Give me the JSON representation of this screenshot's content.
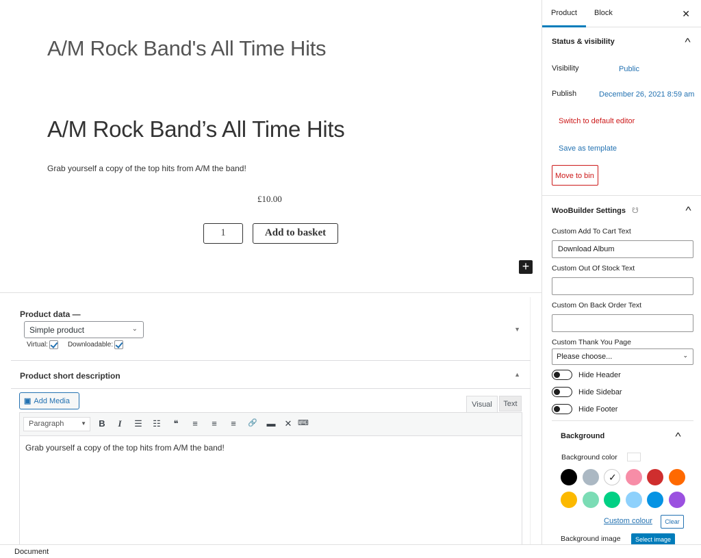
{
  "canvas": {
    "page_title": "A/M Rock Band's All Time Hits",
    "product_title": "A/M Rock Band’s All Time Hits",
    "short_description": "Grab yourself a copy of the top hits from A/M the band!",
    "price": "£10.00",
    "quantity": "1",
    "add_to_basket_label": "Add to basket",
    "add_block_icon": "+"
  },
  "product_data": {
    "label": "Product data —",
    "type_selected": "Simple product",
    "virtual_label": "Virtual:",
    "virtual_checked": true,
    "downloadable_label": "Downloadable:",
    "downloadable_checked": true,
    "toggle_icon": "▼"
  },
  "short_desc_box": {
    "label": "Product short description",
    "toggle_icon": "▲",
    "add_media_label": "Add Media",
    "tab_visual": "Visual",
    "tab_text": "Text",
    "format_selected": "Paragraph",
    "toolbar": [
      {
        "name": "bold",
        "glyph": "B"
      },
      {
        "name": "italic",
        "glyph": "I"
      },
      {
        "name": "bulleted-list",
        "glyph": "☰"
      },
      {
        "name": "numbered-list",
        "glyph": "☷"
      },
      {
        "name": "blockquote",
        "glyph": "❝"
      },
      {
        "name": "align-left",
        "glyph": "≡"
      },
      {
        "name": "align-center",
        "glyph": "≡"
      },
      {
        "name": "align-right",
        "glyph": "≡"
      },
      {
        "name": "link",
        "glyph": "🔗"
      },
      {
        "name": "read-more",
        "glyph": "▬"
      },
      {
        "name": "fullscreen",
        "glyph": "✕"
      },
      {
        "name": "toolbar-toggle",
        "glyph": "⌨"
      }
    ],
    "content": "Grab yourself a copy of the top hits from A/M the band!"
  },
  "sidebar": {
    "tabs": [
      {
        "label": "Product",
        "active": true
      },
      {
        "label": "Block",
        "active": false
      }
    ],
    "close_icon": "✕",
    "status": {
      "title": "Status & visibility",
      "visibility_label": "Visibility",
      "visibility_value": "Public",
      "publish_label": "Publish",
      "publish_value": "December 26, 2021 8:59 am",
      "switch_editor": "Switch to default editor",
      "save_template": "Save as template",
      "move_to_bin": "Move to bin"
    },
    "woobuilder": {
      "title": "WooBuilder Settings",
      "add_to_cart_label": "Custom Add To Cart Text",
      "add_to_cart_value": "Download Album",
      "out_of_stock_label": "Custom Out Of Stock Text",
      "out_of_stock_value": "",
      "back_order_label": "Custom On Back Order Text",
      "back_order_value": "",
      "thank_you_label": "Custom Thank You Page",
      "thank_you_value": "Please choose...",
      "toggles": [
        {
          "label": "Hide Header",
          "on": false
        },
        {
          "label": "Hide Sidebar",
          "on": false
        },
        {
          "label": "Hide Footer",
          "on": false
        }
      ]
    },
    "background": {
      "title": "Background",
      "color_label": "Background color",
      "swatches": [
        {
          "name": "black",
          "color": "#000000"
        },
        {
          "name": "cyan-bluish-gray",
          "color": "#abb8c3"
        },
        {
          "name": "white",
          "color": "#ffffff",
          "selected": true
        },
        {
          "name": "pale-pink",
          "color": "#f78da7"
        },
        {
          "name": "vivid-red",
          "color": "#cf2e2e"
        },
        {
          "name": "luminous-vivid-orange",
          "color": "#ff6900"
        },
        {
          "name": "luminous-vivid-amber",
          "color": "#fcb900"
        },
        {
          "name": "light-green-cyan",
          "color": "#7bdcb5"
        },
        {
          "name": "vivid-green-cyan",
          "color": "#00d084"
        },
        {
          "name": "pale-cyan-blue",
          "color": "#8ed1fc"
        },
        {
          "name": "vivid-cyan-blue",
          "color": "#0693e3"
        },
        {
          "name": "vivid-purple",
          "color": "#9b51e0"
        }
      ],
      "custom_colour": "Custom colour",
      "clear": "Clear",
      "image_label": "Background image",
      "select_image": "Select image"
    }
  },
  "footer": {
    "breadcrumb": "Document"
  }
}
